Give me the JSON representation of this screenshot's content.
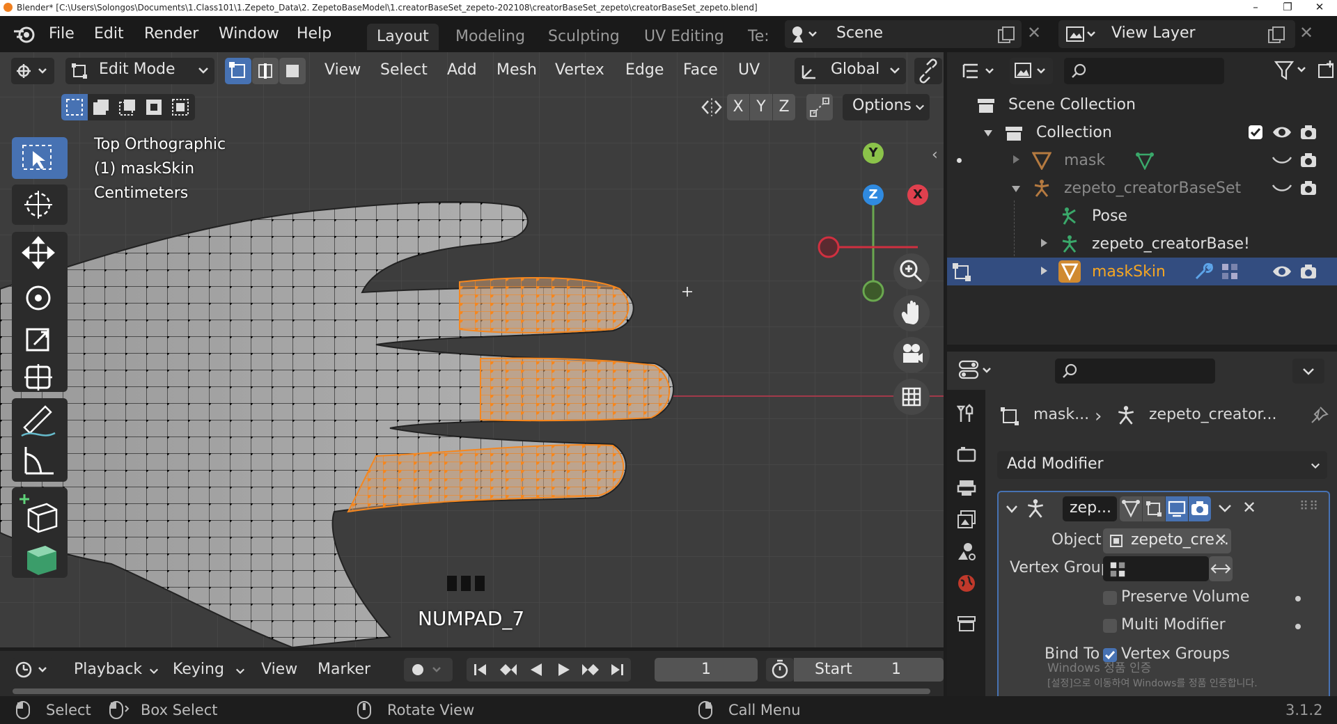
{
  "window": {
    "title": "Blender* [C:\\Users\\Solongos\\Documents\\1.Class101\\1.Zepeto_Data\\2. ZepetoBaseModel\\1.creatorBaseSet_zepeto-202108\\creatorBaseSet_zepeto\\creatorBaseSet_zepeto.blend]",
    "controls": [
      "–",
      "❐",
      "✕"
    ]
  },
  "topbar": {
    "menus": [
      "File",
      "Edit",
      "Render",
      "Window",
      "Help"
    ],
    "workspaces": [
      "Layout",
      "Modeling",
      "Sculpting",
      "UV Editing",
      "Te:"
    ],
    "active_workspace": "Layout",
    "scene": "Scene",
    "view_layer": "View Layer"
  },
  "viewport_header": {
    "mode": "Edit Mode",
    "menus": [
      "View",
      "Select",
      "Add",
      "Mesh",
      "Vertex",
      "Edge",
      "Face",
      "UV"
    ],
    "transform_orientation": "Global",
    "axes": [
      "X",
      "Y",
      "Z"
    ],
    "options": "Options"
  },
  "viewport": {
    "view_name": "Top Orthographic",
    "object_name": "(1) maskSkin",
    "units": "Centimeters",
    "key_display": "NUMPAD_7",
    "gizmo": {
      "y": "Y",
      "z": "Z",
      "x": "X"
    },
    "accent_orange": "#f5871f",
    "background": "#3d3d3d"
  },
  "outliner": {
    "root": "Scene Collection",
    "items": [
      {
        "label": "Collection"
      },
      {
        "label": "mask"
      },
      {
        "label": "zepeto_creatorBaseSet"
      },
      {
        "label": "Pose"
      },
      {
        "label": "zepeto_creatorBase!"
      },
      {
        "label": "maskSkin"
      }
    ]
  },
  "properties": {
    "breadcrumb_object": "mask...",
    "breadcrumb_target": "zepeto_creator...",
    "add_modifier": "Add Modifier",
    "modifier_name": "zep...",
    "object_label": "Object",
    "object_value": "zepeto_cre...",
    "vertex_group_label": "Vertex Group",
    "preserve_volume": "Preserve Volume",
    "multi_modifier": "Multi Modifier",
    "bind_to_label": "Bind To",
    "vertex_groups": "Vertex Groups"
  },
  "timeline": {
    "menus": [
      "Playback",
      "Keying",
      "View",
      "Marker"
    ],
    "current_frame": "1",
    "start_label": "Start",
    "start_value": "1"
  },
  "statusbar": {
    "select": "Select",
    "box_select": "Box Select",
    "rotate_view": "Rotate View",
    "call_menu": "Call Menu",
    "version": "3.1.2"
  },
  "watermark": {
    "line1": "Windows 정품 인증",
    "line2": "[설정]으로 이동하여 Windows를 정품 인증합니다."
  }
}
